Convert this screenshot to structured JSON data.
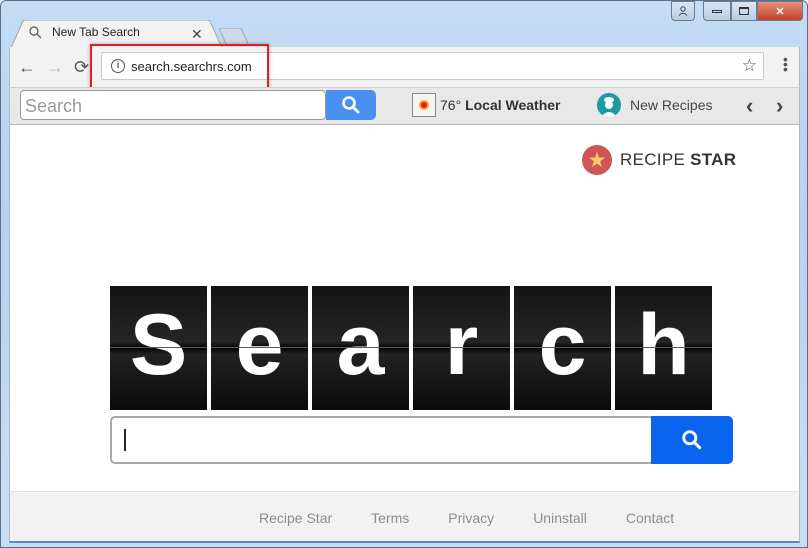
{
  "browser": {
    "tab": {
      "title": "New Tab Search",
      "close_icon": "close-icon"
    },
    "address_bar": {
      "url": "search.searchrs.com",
      "info_icon": "info-icon",
      "bookmark_icon": "star-icon"
    },
    "nav": {
      "back": "←",
      "forward": "→",
      "reload": "⟳"
    },
    "window_controls": {
      "profile": "user-icon",
      "minimize": "minimize-icon",
      "maximize": "maximize-icon",
      "close": "close-icon"
    }
  },
  "extension_bar": {
    "search_placeholder": "Search",
    "weather": {
      "temperature": "76°",
      "label": "Local Weather"
    },
    "recipes_label": "New Recipes",
    "prev_label": "‹",
    "next_label": "›"
  },
  "page": {
    "brand": {
      "prefix": "RECIPE ",
      "suffix": "STAR"
    },
    "hero_letters": [
      "S",
      "e",
      "a",
      "r",
      "c",
      "h"
    ],
    "search_value": "",
    "accent_color": "#0a64f0"
  },
  "footer": {
    "links": [
      "Recipe Star",
      "Terms",
      "Privacy",
      "Uninstall",
      "Contact"
    ]
  }
}
